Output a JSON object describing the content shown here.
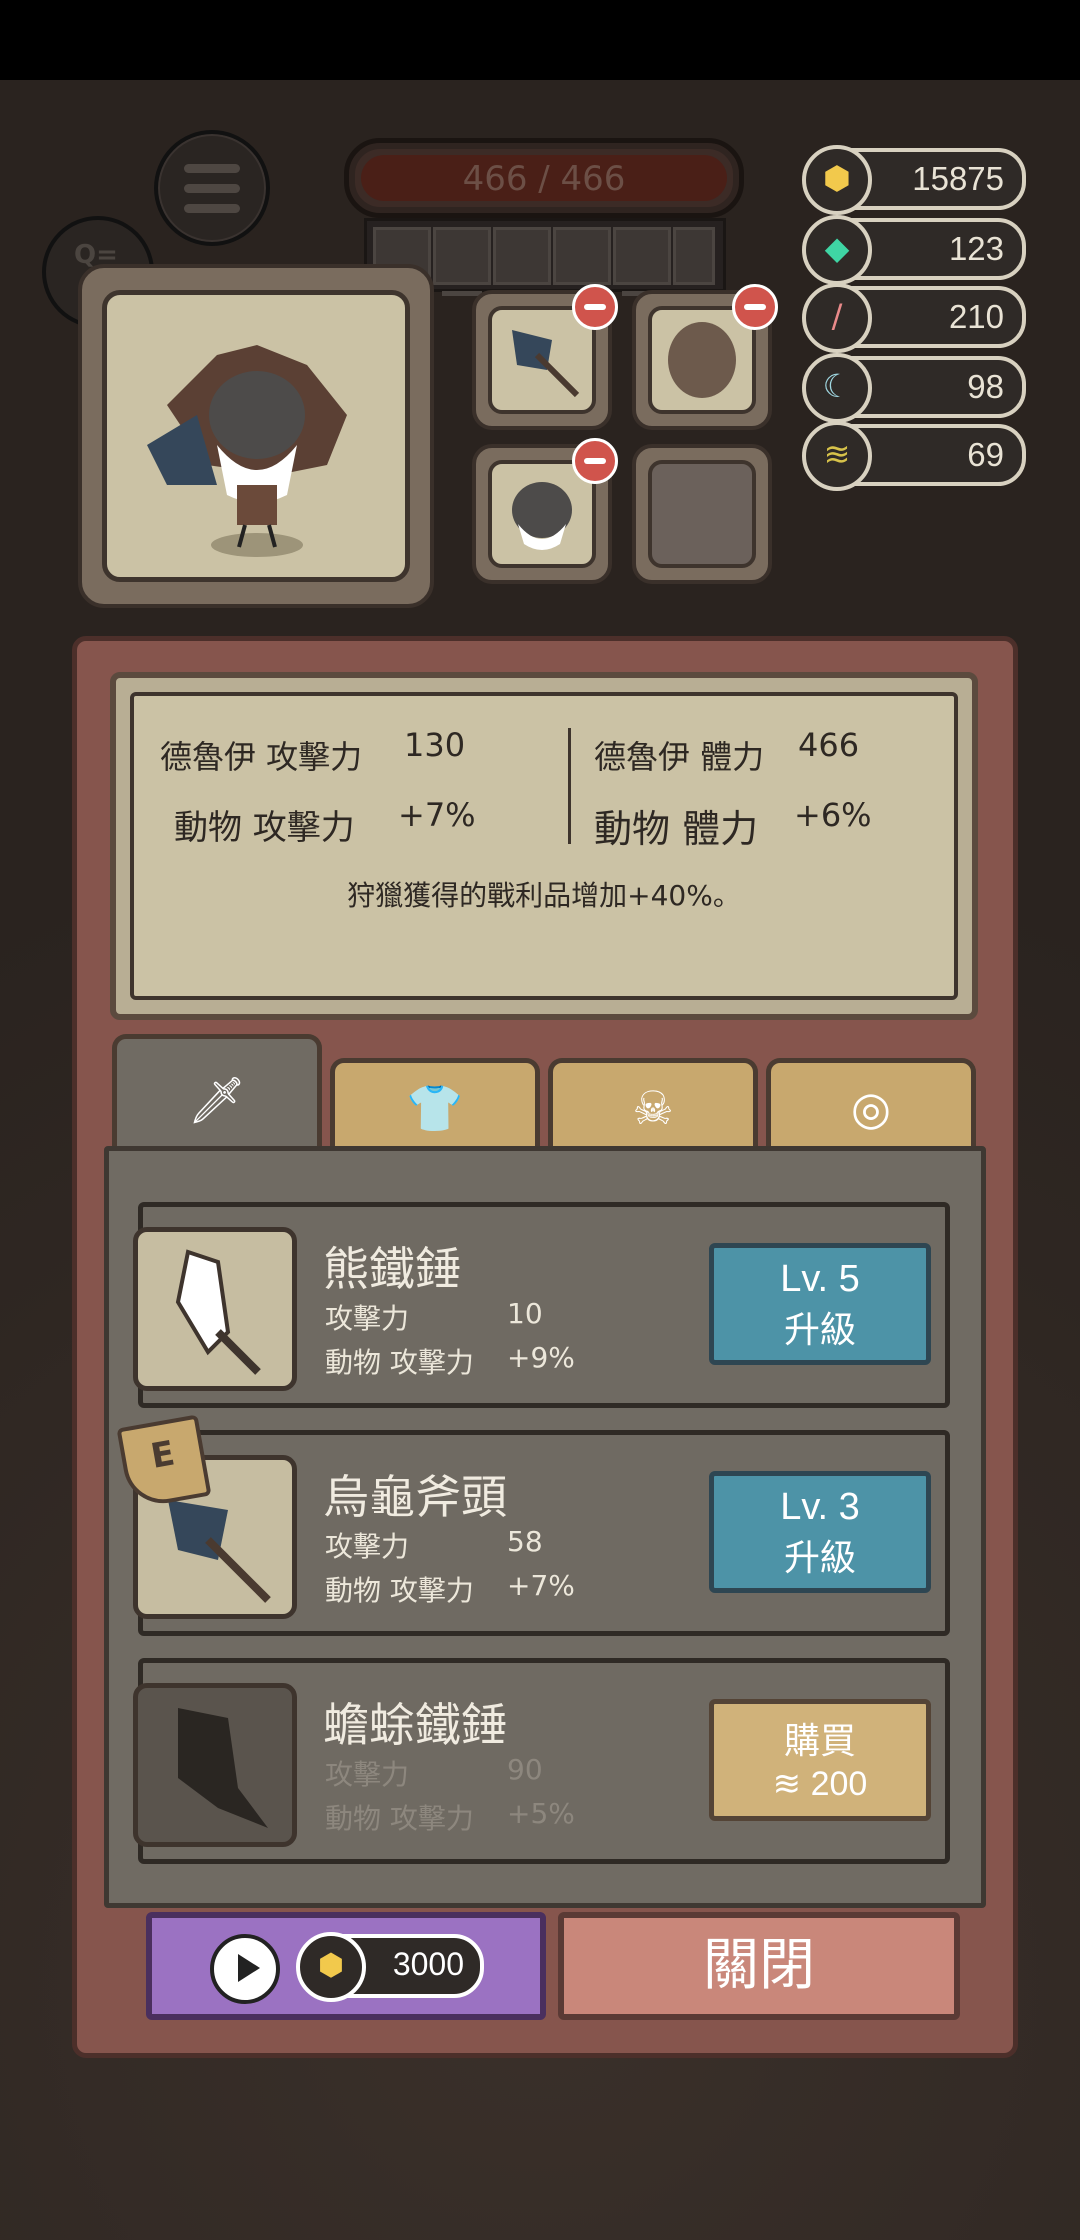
{
  "hud": {
    "hp_text": "466 / 466",
    "quest_icon": "quest-list-icon",
    "menu_icon": "menu-icon"
  },
  "resources": [
    {
      "name": "gold",
      "icon": "gold-nugget-icon",
      "value": "15875",
      "color": "#f2c94c"
    },
    {
      "name": "gem",
      "icon": "gem-icon",
      "value": "123",
      "color": "#3fd5a4"
    },
    {
      "name": "bone",
      "icon": "bone-icon",
      "value": "210",
      "color": "#e98a8a"
    },
    {
      "name": "claw",
      "icon": "claw-icon",
      "value": "98",
      "color": "#9fd6e0"
    },
    {
      "name": "feather",
      "icon": "feather-icon",
      "value": "69",
      "color": "#d7c24a"
    }
  ],
  "stats": {
    "druid_attack_label": "德魯伊 攻擊力",
    "druid_attack_value": "130",
    "druid_hp_label": "德魯伊 體力",
    "druid_hp_value": "466",
    "animal_attack_label": "動物 攻擊力",
    "animal_attack_value": "+7%",
    "animal_hp_label": "動物 體力",
    "animal_hp_value": "+6%",
    "note": "狩獵獲得的戰利品增加+40%。"
  },
  "tabs": [
    {
      "icon": "sword-icon",
      "active": true
    },
    {
      "icon": "armor-icon",
      "active": false
    },
    {
      "icon": "skull-mask-icon",
      "active": false
    },
    {
      "icon": "rune-stone-icon",
      "active": false
    }
  ],
  "items": [
    {
      "name": "熊鐵錘",
      "l1": "攻擊力",
      "v1": "10",
      "l2": "動物 攻擊力",
      "v2": "+9%",
      "btn_level": "Lv. 5",
      "btn_action": "升級"
    },
    {
      "name": "烏龜斧頭",
      "l1": "攻擊力",
      "v1": "58",
      "l2": "動物 攻擊力",
      "v2": "+7%",
      "btn_level": "Lv. 3",
      "btn_action": "升級",
      "badge": "E"
    },
    {
      "name": "蟾蜍鐵錘",
      "l1": "攻擊力",
      "v1": "90",
      "l2": "動物 攻擊力",
      "v2": "+5%",
      "buy_label": "購買",
      "price": "200"
    }
  ],
  "footer": {
    "ad_amount": "3000",
    "close_label": "關閉"
  }
}
